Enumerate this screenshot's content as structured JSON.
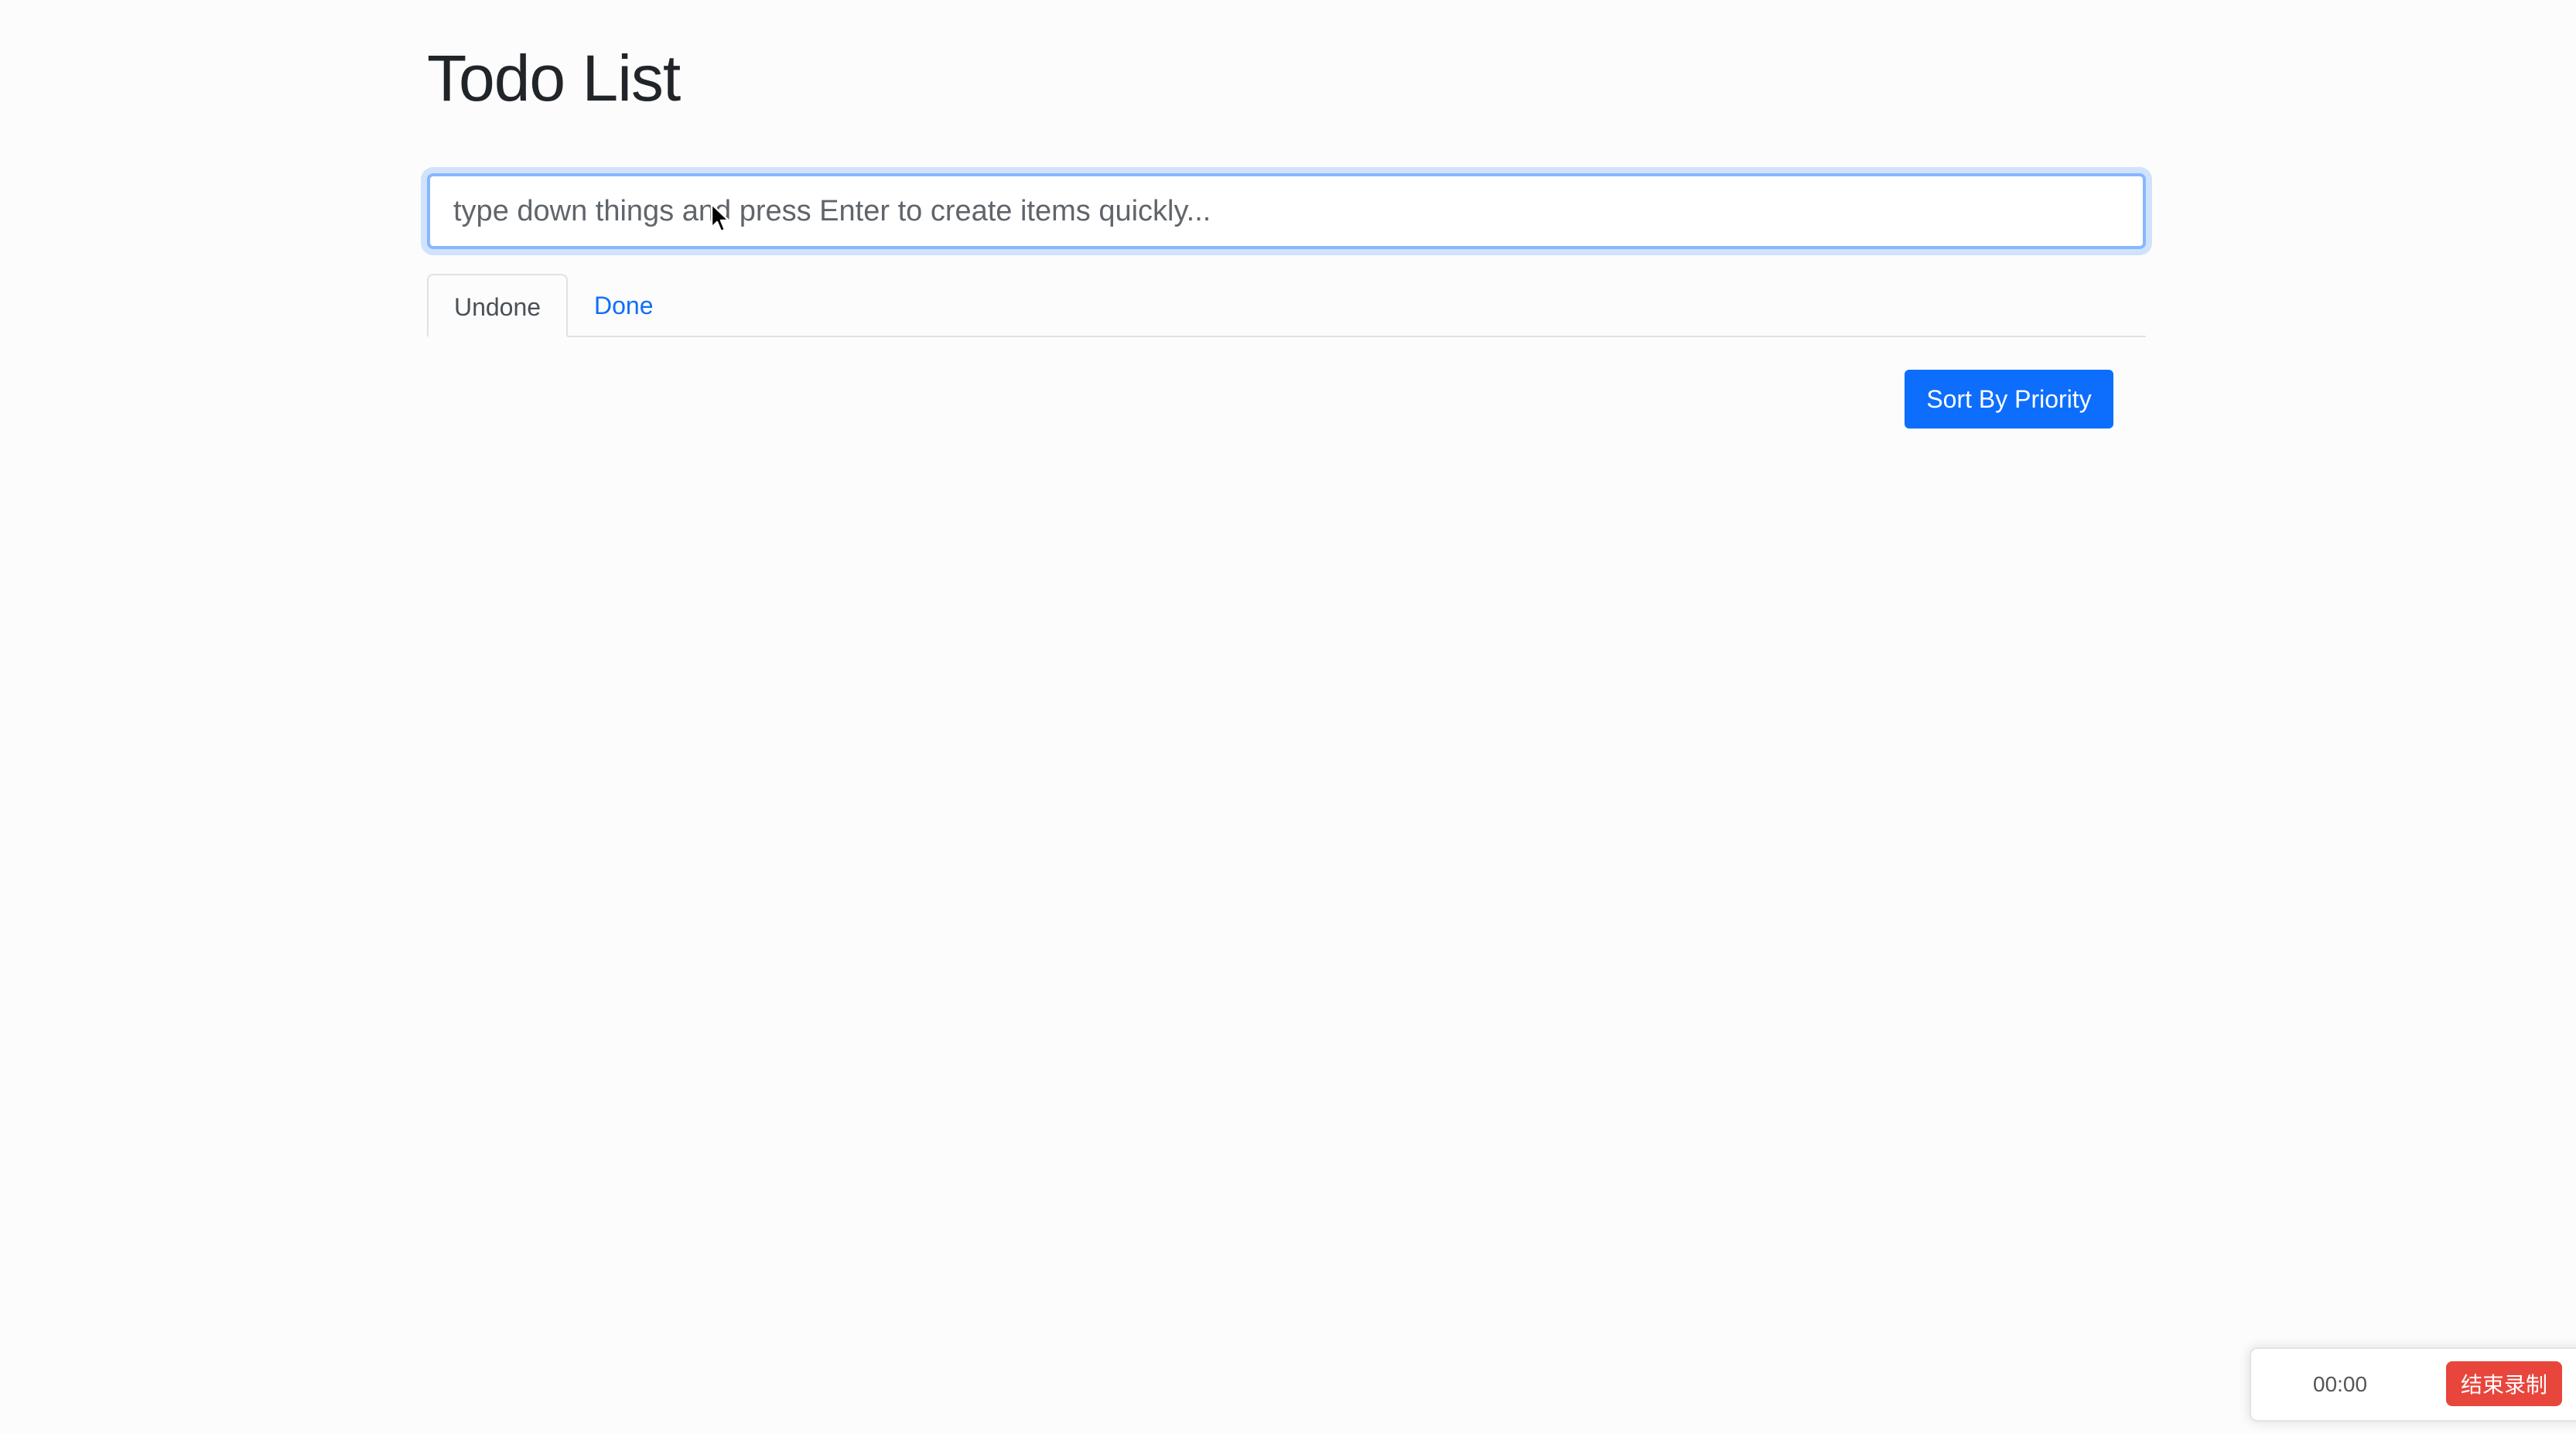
{
  "app": {
    "title": "Todo List"
  },
  "input": {
    "placeholder": "type down things and press Enter to create items quickly...",
    "value": ""
  },
  "tabs": [
    {
      "label": "Undone",
      "active": true
    },
    {
      "label": "Done",
      "active": false
    }
  ],
  "toolbar": {
    "sort_label": "Sort By Priority"
  },
  "recorder": {
    "time": "00:00",
    "stop_label": "结束录制"
  },
  "colors": {
    "primary": "#0d6efd",
    "stop": "#e8453c",
    "background": "#fcfcfc"
  }
}
